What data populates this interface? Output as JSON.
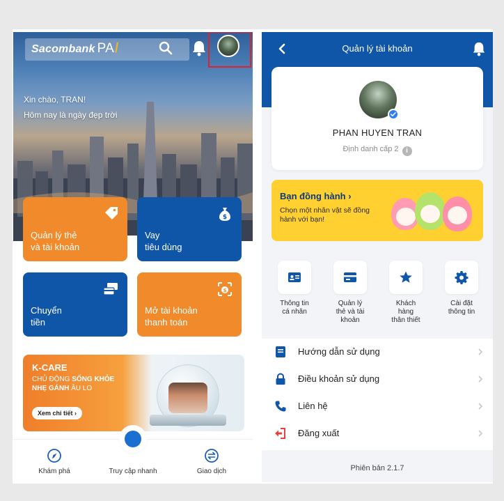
{
  "left": {
    "brand": {
      "name": "Sacombank",
      "suffix": "PAY"
    },
    "greeting": {
      "line1": "Xin chào, TRAN!",
      "line2": "Hôm nay là ngày đẹp trời"
    },
    "tiles": [
      {
        "label": "Quản lý thẻ\nvà tài khoản",
        "icon": "card-tag-icon",
        "color": "#f08a2b"
      },
      {
        "label": "Vay\ntiêu dùng",
        "icon": "money-bag-icon",
        "color": "#0f56a8"
      },
      {
        "label": "Chuyển\ntiền",
        "icon": "transfer-cards-icon",
        "color": "#0f56a8"
      },
      {
        "label": "Mở tài khoản\nthanh toán",
        "icon": "open-account-icon",
        "color": "#f08a2b"
      }
    ],
    "banner": {
      "title": "K-CARE",
      "sub_pre": "CHỦ ĐỘNG ",
      "sub_bold1": "SỐNG KHỎE",
      "sub_bold2": "NHẸ GÁNH",
      "sub_post": " ÂU LO",
      "button": "Xem chi tiết"
    },
    "nav": [
      {
        "label": "Khám phá",
        "icon": "compass-icon"
      },
      {
        "label": "Truy cập nhanh",
        "icon": "quick-access-icon"
      },
      {
        "label": "Giao dịch",
        "icon": "exchange-icon"
      }
    ]
  },
  "right": {
    "header_title": "Quản lý tài khoản",
    "profile": {
      "name": "PHAN HUYEN TRAN",
      "level": "Định danh cấp 2",
      "info_glyph": "i"
    },
    "companion": {
      "title": "Bạn đồng hành ›",
      "subtitle": "Chọn một nhân vật sẽ đồng hành với bạn!"
    },
    "quick_actions": [
      {
        "label": "Thông tin\ncá nhân",
        "icon": "id-card-icon"
      },
      {
        "label": "Quản lý\nthẻ và tài\nkhoản",
        "icon": "credit-card-icon"
      },
      {
        "label": "Khách\nhàng\nthân thiết",
        "icon": "star-icon"
      },
      {
        "label": "Cài đặt\nthông tin",
        "icon": "gear-icon"
      }
    ],
    "menu": [
      {
        "label": "Hướng dẫn sử dụng",
        "icon": "guide-book-icon"
      },
      {
        "label": "Điều khoản sử dụng",
        "icon": "lock-icon"
      },
      {
        "label": "Liên hệ",
        "icon": "phone-icon"
      },
      {
        "label": "Đăng xuất",
        "icon": "logout-icon"
      }
    ],
    "version": "Phiên bản 2.1.7"
  },
  "colors": {
    "primary_blue": "#0f56a8",
    "accent_orange": "#f08a2b",
    "highlight_red": "#d9252b",
    "yellow": "#ffd02f"
  }
}
